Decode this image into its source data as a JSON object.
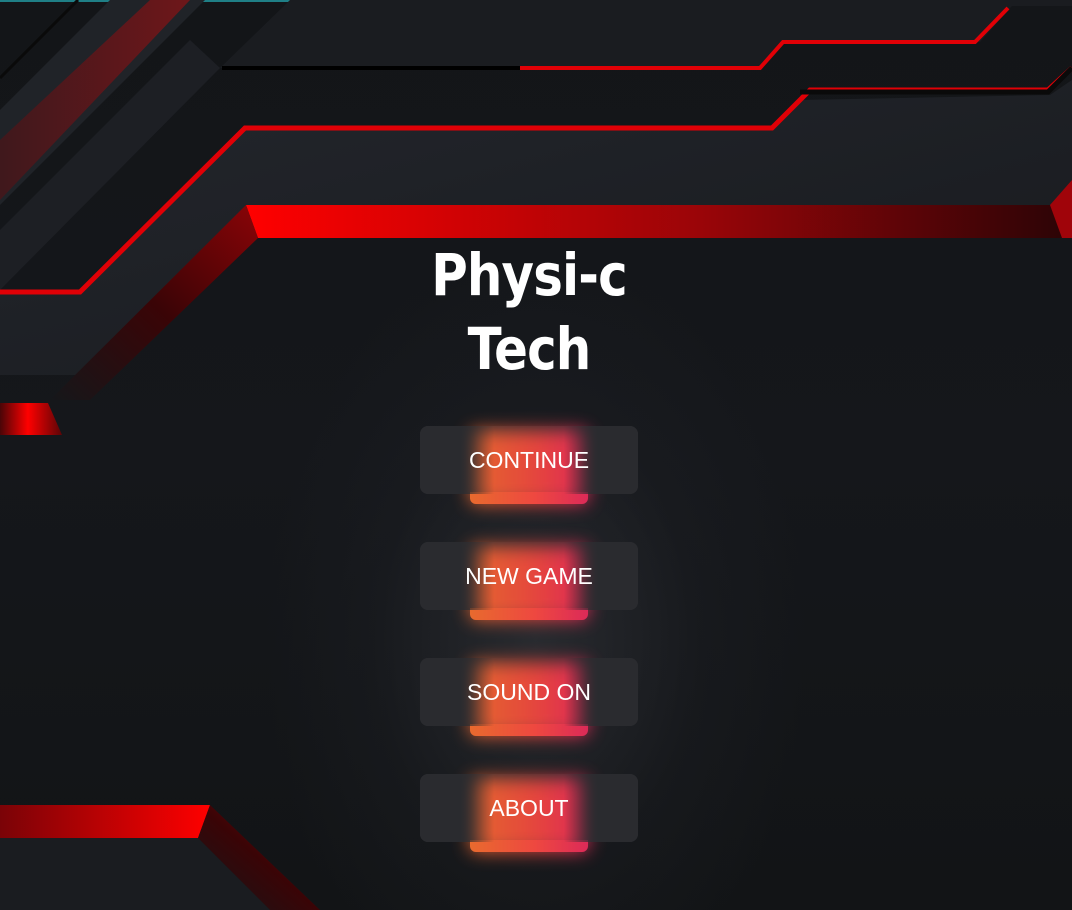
{
  "game": {
    "title_line1": "Physi-c",
    "title_line2": "Tech"
  },
  "menu": {
    "buttons": [
      {
        "label": "CONTINUE"
      },
      {
        "label": "NEW GAME"
      },
      {
        "label": "SOUND ON"
      },
      {
        "label": "ABOUT"
      }
    ]
  },
  "colors": {
    "background": "#121417",
    "accent_red": "#ff0000",
    "button_face": "#2a2b2f",
    "button_glow_left": "#ee6a2f",
    "button_glow_right": "#e6285a",
    "text": "#ffffff"
  }
}
